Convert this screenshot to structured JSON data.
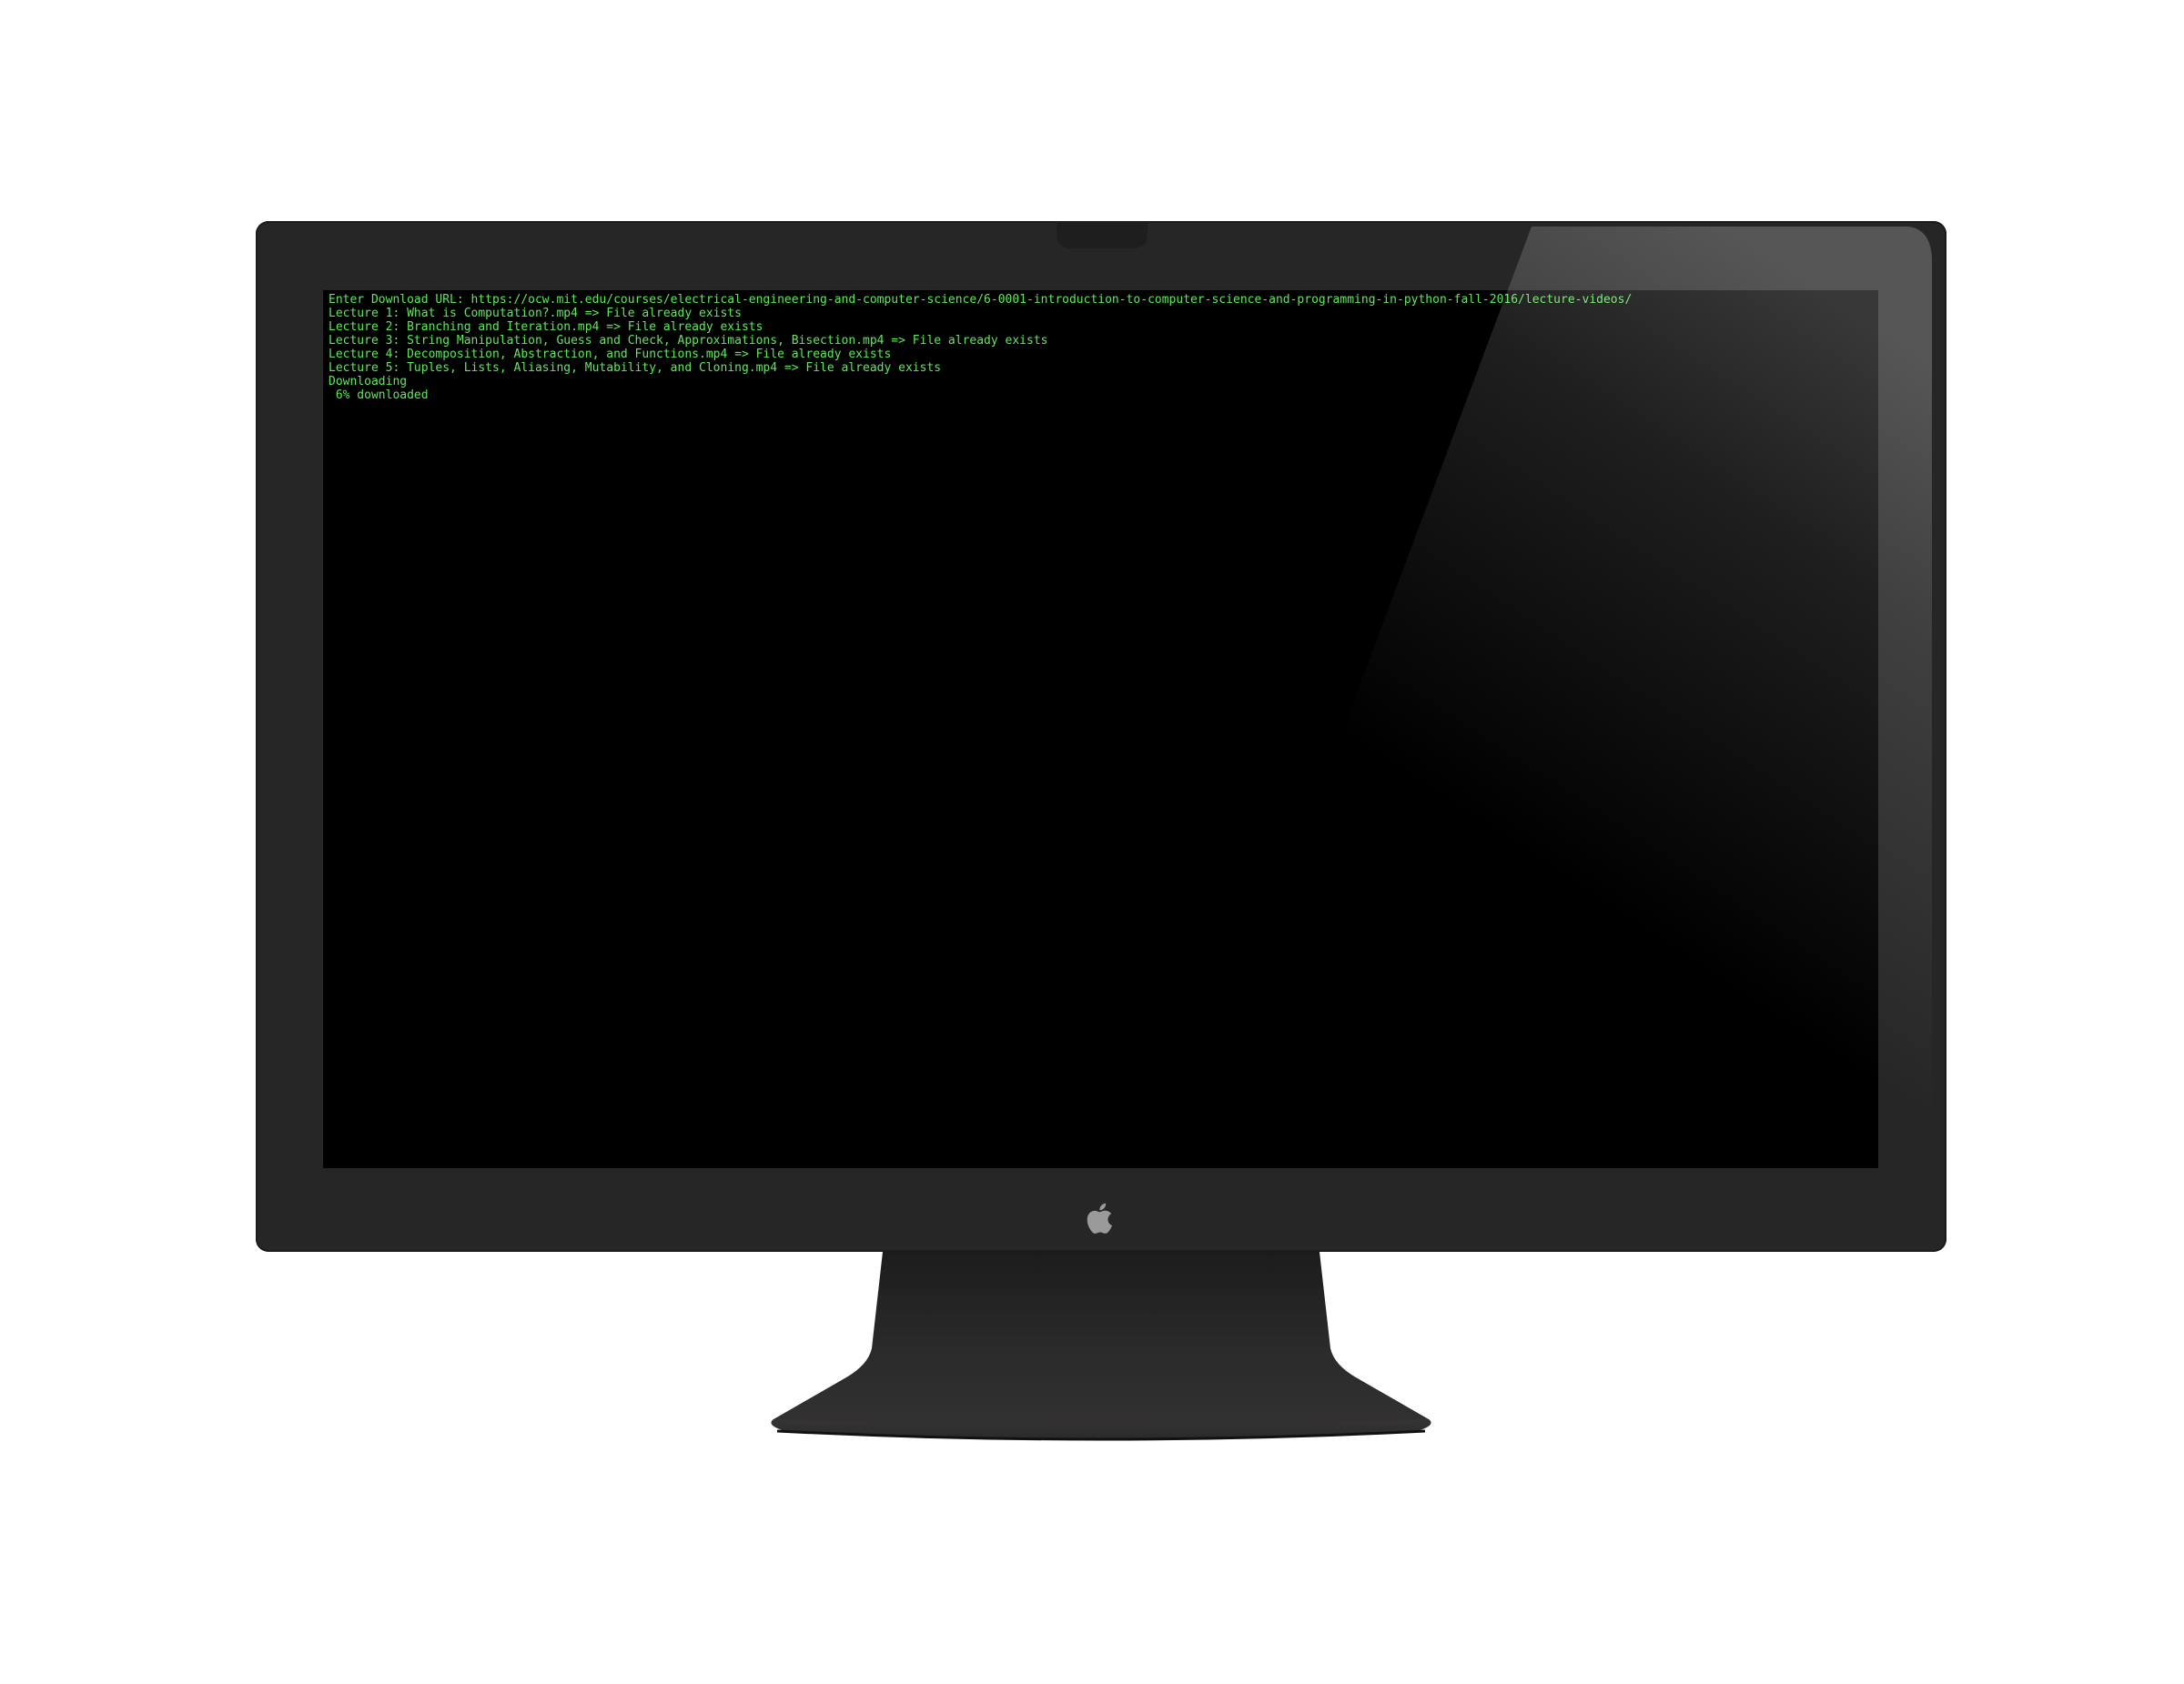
{
  "terminal": {
    "lines": [
      "Enter Download URL: https://ocw.mit.edu/courses/electrical-engineering-and-computer-science/6-0001-introduction-to-computer-science-and-programming-in-python-fall-2016/lecture-videos/",
      "Lecture 1: What is Computation?.mp4 => File already exists",
      "Lecture 2: Branching and Iteration.mp4 => File already exists",
      "Lecture 3: String Manipulation, Guess and Check, Approximations, Bisection.mp4 => File already exists",
      "Lecture 4: Decomposition, Abstraction, and Functions.mp4 => File already exists",
      "Lecture 5: Tuples, Lists, Aliasing, Mutability, and Cloning.mp4 => File already exists",
      "Downloading",
      " 6% downloaded"
    ],
    "text_color": "#5fe85a",
    "background_color": "#000000"
  },
  "monitor": {
    "bezel_color": "#262626",
    "logo_icon": "apple-logo-icon"
  }
}
